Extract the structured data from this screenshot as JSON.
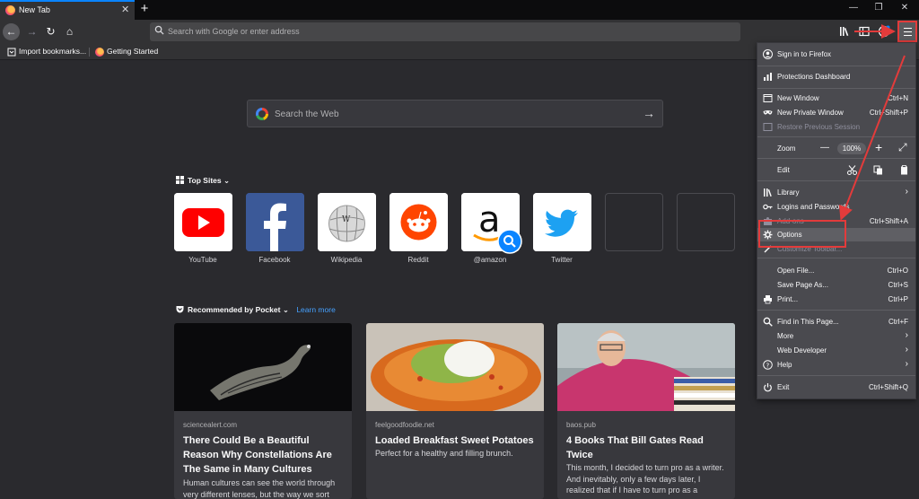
{
  "tab": {
    "title": "New Tab",
    "close": "✕",
    "new_tab": "+"
  },
  "window_controls": {
    "minimize": "—",
    "maximize": "❐",
    "close": "✕"
  },
  "nav": {
    "back": "←",
    "forward": "→",
    "reload": "↻",
    "home": "⌂"
  },
  "urlbar": {
    "placeholder": "Search with Google or enter address"
  },
  "bookmarks": [
    {
      "label": "Import bookmarks..."
    },
    {
      "label": "Getting Started"
    }
  ],
  "websearch": {
    "placeholder": "Search the Web",
    "arrow": "→"
  },
  "top_sites": {
    "heading": "Top Sites",
    "sites": [
      {
        "label": "YouTube"
      },
      {
        "label": "Facebook"
      },
      {
        "label": "Wikipedia"
      },
      {
        "label": "Reddit"
      },
      {
        "label": "@amazon"
      },
      {
        "label": "Twitter"
      }
    ]
  },
  "pocket": {
    "heading": "Recommended by Pocket",
    "learn_more": "Learn more",
    "cards": [
      {
        "source": "sciencealert.com",
        "title": "There Could Be a Beautiful Reason Why Constellations Are The Same in Many Cultures",
        "desc": "Human cultures can see the world through very different lenses, but the way we sort"
      },
      {
        "source": "feelgoodfoodie.net",
        "title": "Loaded Breakfast Sweet Potatoes",
        "desc": "Perfect for a healthy and filling brunch."
      },
      {
        "source": "baos.pub",
        "title": "4 Books That Bill Gates Read Twice",
        "desc": "This month, I decided to turn pro as a writer. And inevitably, only a few days later, I realized that if I have to turn pro as a"
      }
    ]
  },
  "menu": {
    "sign_in": "Sign in to Firefox",
    "protections": "Protections Dashboard",
    "new_window": {
      "label": "New Window",
      "shortcut": "Ctrl+N"
    },
    "private_window": {
      "label": "New Private Window",
      "shortcut": "Ctrl+Shift+P"
    },
    "restore": "Restore Previous Session",
    "zoom": {
      "label": "Zoom",
      "minus": "—",
      "value": "100%",
      "plus": "+",
      "full": "⤢"
    },
    "edit": {
      "label": "Edit"
    },
    "library": "Library",
    "logins": "Logins and Passwords",
    "addons": {
      "label": "Add-ons",
      "shortcut": "Ctrl+Shift+A"
    },
    "options": "Options",
    "customize": "Customize Toolbar...",
    "open_file": {
      "label": "Open File...",
      "shortcut": "Ctrl+O"
    },
    "save_page": {
      "label": "Save Page As...",
      "shortcut": "Ctrl+S"
    },
    "print": {
      "label": "Print...",
      "shortcut": "Ctrl+P"
    },
    "find": {
      "label": "Find in This Page...",
      "shortcut": "Ctrl+F"
    },
    "more": "More",
    "web_dev": "Web Developer",
    "help": "Help",
    "exit": {
      "label": "Exit",
      "shortcut": "Ctrl+Shift+Q"
    }
  },
  "colors": {
    "accent": "#0a84ff",
    "annotation": "#e33b3b",
    "menu_bg": "#4a4a4f",
    "page_bg": "#2a2a2e"
  }
}
